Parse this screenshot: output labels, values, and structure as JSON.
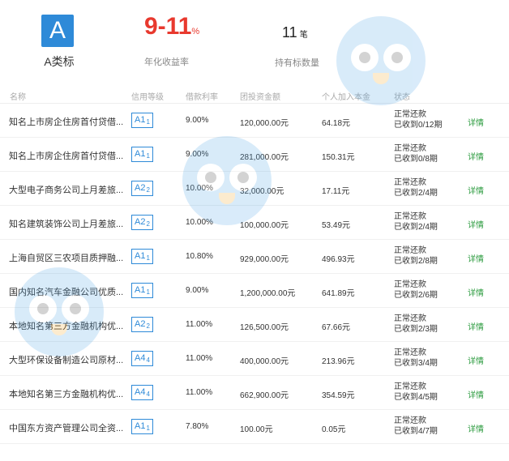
{
  "header": {
    "badge": "A",
    "badge_label": "A类标",
    "rate_value": "9-11",
    "rate_unit": "%",
    "rate_label": "年化收益率",
    "count_value": "11",
    "count_unit": "笔",
    "count_label": "持有标数量"
  },
  "table": {
    "columns": [
      "名称",
      "信用等级",
      "借款利率",
      "团投资金额",
      "个人加入本金",
      "状态"
    ],
    "rows": [
      {
        "name": "知名上市房企住房首付贷借...",
        "grade": "A1",
        "grade_sub": "1",
        "rate": "9.00%",
        "amount": "120,000.00元",
        "personal": "64.18元",
        "status1": "正常还款",
        "status2": "已收到0/12期",
        "detail": "详情"
      },
      {
        "name": "知名上市房企住房首付贷借...",
        "grade": "A1",
        "grade_sub": "1",
        "rate": "9.00%",
        "amount": "281,000.00元",
        "personal": "150.31元",
        "status1": "正常还款",
        "status2": "已收到0/8期",
        "detail": "详情"
      },
      {
        "name": "大型电子商务公司上月差旅...",
        "grade": "A2",
        "grade_sub": "2",
        "rate": "10.00%",
        "amount": "32,000.00元",
        "personal": "17.11元",
        "status1": "正常还款",
        "status2": "已收到2/4期",
        "detail": "详情"
      },
      {
        "name": "知名建筑装饰公司上月差旅...",
        "grade": "A2",
        "grade_sub": "2",
        "rate": "10.00%",
        "amount": "100,000.00元",
        "personal": "53.49元",
        "status1": "正常还款",
        "status2": "已收到2/4期",
        "detail": "详情"
      },
      {
        "name": "上海自贸区三农项目质押融...",
        "grade": "A1",
        "grade_sub": "1",
        "rate": "10.80%",
        "amount": "929,000.00元",
        "personal": "496.93元",
        "status1": "正常还款",
        "status2": "已收到2/8期",
        "detail": "详情"
      },
      {
        "name": "国内知名汽车金融公司优质...",
        "grade": "A1",
        "grade_sub": "1",
        "rate": "9.00%",
        "amount": "1,200,000.00元",
        "personal": "641.89元",
        "status1": "正常还款",
        "status2": "已收到2/6期",
        "detail": "详情"
      },
      {
        "name": "本地知名第三方金融机构优...",
        "grade": "A2",
        "grade_sub": "2",
        "rate": "11.00%",
        "amount": "126,500.00元",
        "personal": "67.66元",
        "status1": "正常还款",
        "status2": "已收到2/3期",
        "detail": "详情"
      },
      {
        "name": "大型环保设备制造公司原材...",
        "grade": "A4",
        "grade_sub": "4",
        "rate": "11.00%",
        "amount": "400,000.00元",
        "personal": "213.96元",
        "status1": "正常还款",
        "status2": "已收到3/4期",
        "detail": "详情"
      },
      {
        "name": "本地知名第三方金融机构优...",
        "grade": "A4",
        "grade_sub": "4",
        "rate": "11.00%",
        "amount": "662,900.00元",
        "personal": "354.59元",
        "status1": "正常还款",
        "status2": "已收到4/5期",
        "detail": "详情"
      },
      {
        "name": "中国东方资产管理公司全资...",
        "grade": "A1",
        "grade_sub": "1",
        "rate": "7.80%",
        "amount": "100.00元",
        "personal": "0.05元",
        "status1": "正常还款",
        "status2": "已收到4/7期",
        "detail": "详情"
      }
    ]
  },
  "colors": {
    "accent": "#2e8ad8",
    "rate": "#e8392e",
    "detail": "#2a9a3d"
  }
}
